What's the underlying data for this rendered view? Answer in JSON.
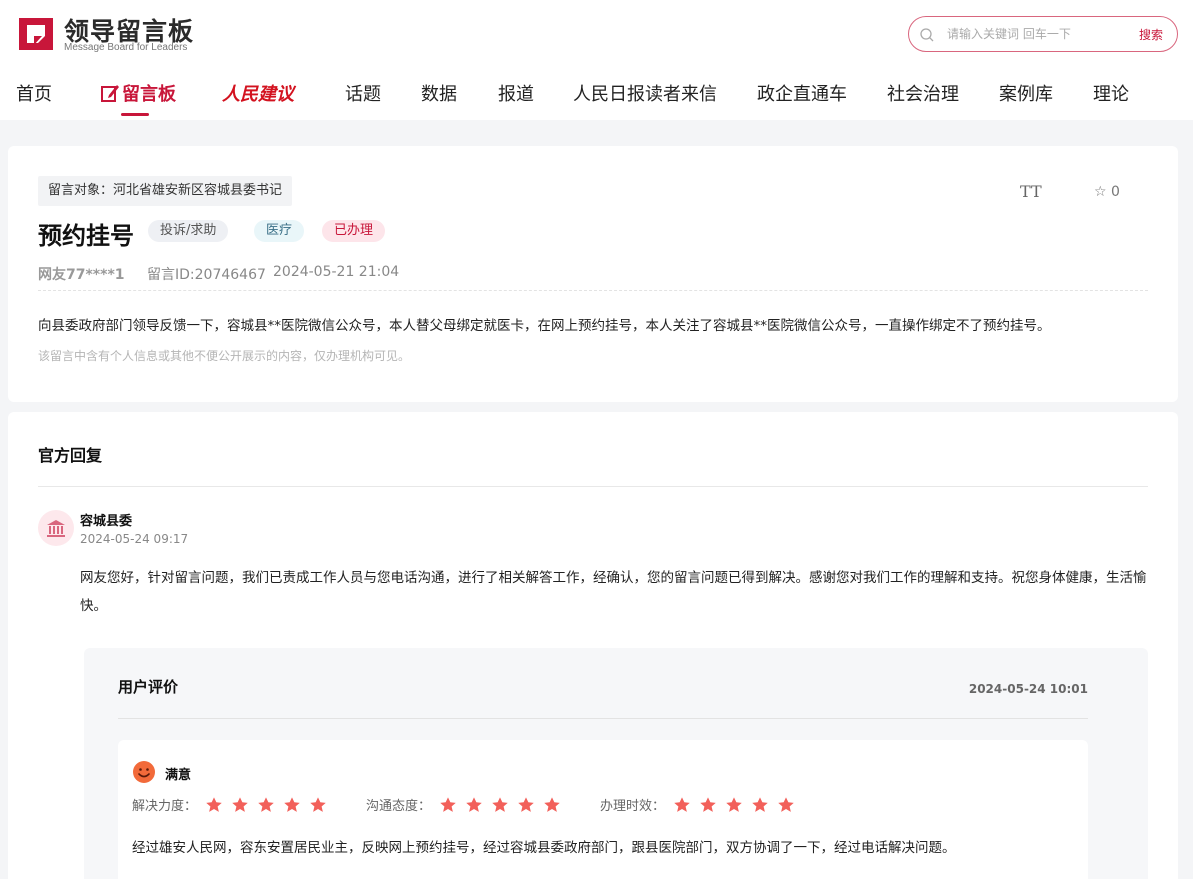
{
  "brand": {
    "title": "领导留言板",
    "subtitle": "Message Board for Leaders",
    "accent": "#c8163a"
  },
  "search": {
    "placeholder": "请输入关键词 回车一下",
    "button": "搜索"
  },
  "nav": {
    "items": [
      "首页",
      "留言板",
      "人民建议",
      "话题",
      "数据",
      "报道",
      "人民日报读者来信",
      "政企直通车",
      "社会治理",
      "案例库",
      "理论"
    ],
    "active": "留言板"
  },
  "message": {
    "target": "留言对象：河北省雄安新区容城县委书记",
    "title": "预约挂号",
    "tags": [
      "投诉/求助",
      "医疗",
      "已办理"
    ],
    "user": "网友77****1",
    "id": "留言ID:20746467",
    "date": "2024-05-21 21:04",
    "content": "向县委政府部门领导反馈一下，容城县**医院微信公众号，本人替父母绑定就医卡，在网上预约挂号，本人关注了容城县**医院微信公众号，一直操作绑定不了预约挂号。",
    "notice": "该留言中含有个人信息或其他不便公开展示的内容，仅办理机构可见。",
    "font_toggle": "TT",
    "fav_count": "0"
  },
  "reply": {
    "section_title": "官方回复",
    "org": "容城县委",
    "time": "2024-05-24 09:17",
    "text": "网友您好，针对留言问题，我们已责成工作人员与您电话沟通，进行了相关解答工作，经确认，您的留言问题已得到解决。感谢您对我们工作的理解和支持。祝您身体健康，生活愉快。"
  },
  "evaluation": {
    "title": "用户评价",
    "time": "2024-05-24 10:01",
    "satisfaction": "满意",
    "ratings": [
      {
        "label": "解决力度：",
        "stars": 5
      },
      {
        "label": "沟通态度：",
        "stars": 5
      },
      {
        "label": "办理时效：",
        "stars": 5
      }
    ],
    "text": "经过雄安人民网，容东安置居民业主，反映网上预约挂号，经过容城县委政府部门，跟县医院部门，双方协调了一下，经过电话解决问题。"
  }
}
